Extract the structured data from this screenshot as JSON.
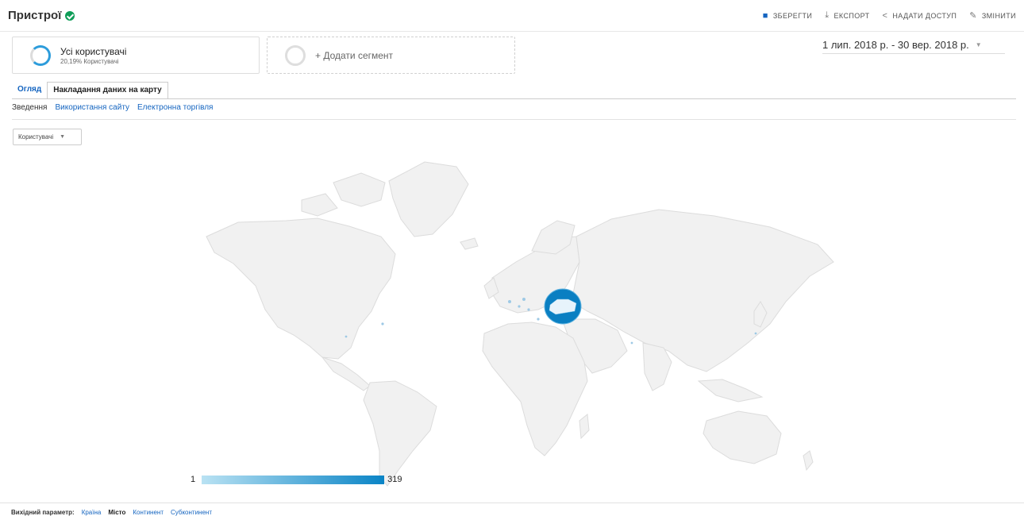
{
  "header": {
    "title": "Пристрої",
    "actions": {
      "save": "ЗБЕРЕГТИ",
      "export": "ЕКСПОРТ",
      "share": "НАДАТИ ДОСТУП",
      "edit": "ЗМІНИТИ"
    }
  },
  "segments": {
    "primary": {
      "name": "Усі користувачі",
      "subtitle": "20,19% Користувачі"
    },
    "add_label": "+ Додати сегмент"
  },
  "date_range": "1 лип. 2018 р. - 30 вер. 2018 р.",
  "tabs": [
    {
      "label": "Огляд"
    },
    {
      "label": "Накладання даних на карту"
    }
  ],
  "subtabs": [
    {
      "label": "Зведення"
    },
    {
      "label": "Використання сайту"
    },
    {
      "label": "Електронна торгівля"
    }
  ],
  "metric_select": "Користувачі",
  "map": {
    "highlight_country": "Ukraine",
    "highlight_color": "#0a7fc2",
    "land_color": "#f1f1f1"
  },
  "legend": {
    "min": "1",
    "max": "319",
    "low_color": "#b9e2f3",
    "high_color": "#0a84c6"
  },
  "footer": {
    "label": "Вихідний параметр:",
    "options": [
      "Країна",
      "Місто",
      "Континент",
      "Субконтинент"
    ],
    "current": "Місто"
  },
  "colors": {
    "accent": "#1565c0",
    "verified": "#0f9d58"
  }
}
